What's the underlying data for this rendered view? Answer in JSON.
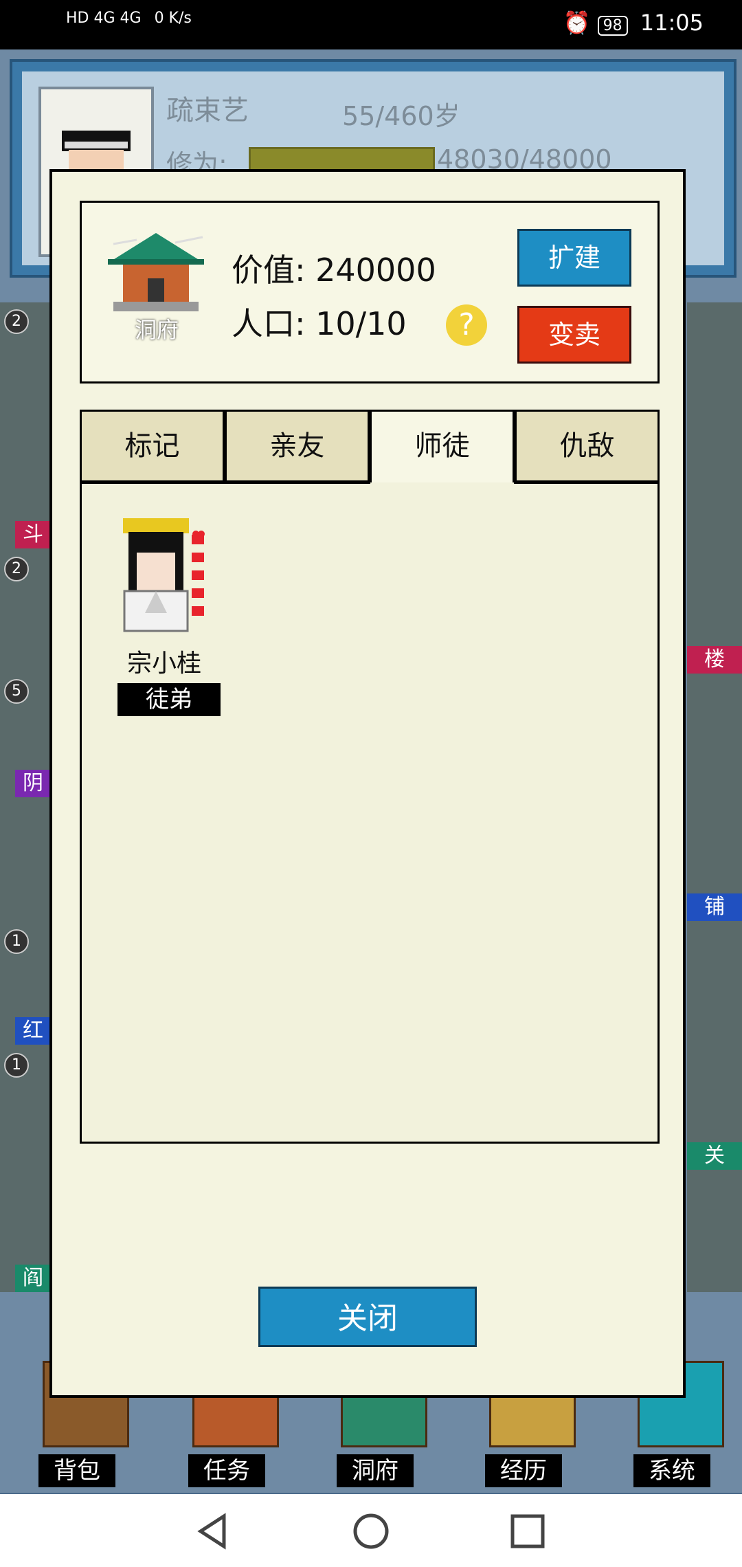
{
  "status_bar": {
    "network": "HD 4G 4G",
    "speed": "0 K/s",
    "battery": "98",
    "time": "11:05"
  },
  "header": {
    "name": "疏束艺",
    "age": "55/460岁",
    "xiuwei_label": "修为:",
    "xiuwei_value": "48030/48000",
    "xiuwei_progress": 1.0
  },
  "side_left": {
    "badges": [
      "2",
      "2",
      "5",
      "1",
      "1"
    ],
    "tags": [
      "斗",
      "阴",
      "红",
      "阎"
    ]
  },
  "side_right": {
    "tags": [
      "楼",
      "铺",
      "关"
    ]
  },
  "dialog": {
    "house_caption": "洞府",
    "value": "价值: 240000",
    "population": "人口: 10/10",
    "help": "?",
    "expand_button": "扩建",
    "sell_button": "变卖",
    "tabs": [
      {
        "label": "标记",
        "active": false
      },
      {
        "label": "亲友",
        "active": false
      },
      {
        "label": "师徒",
        "active": true
      },
      {
        "label": "仇敌",
        "active": false
      }
    ],
    "members": [
      {
        "name": "宗小桂",
        "role": "徒弟",
        "hearts": 5
      }
    ],
    "close_button": "关闭"
  },
  "bottom_nav": [
    {
      "label": "背包",
      "icon": "bag-icon"
    },
    {
      "label": "任务",
      "icon": "task-icon"
    },
    {
      "label": "洞府",
      "icon": "cave-house-icon"
    },
    {
      "label": "经历",
      "icon": "book-icon"
    },
    {
      "label": "系统",
      "icon": "gear-icon"
    }
  ],
  "colors": {
    "dialog_bg": "#f4f4e0",
    "expand_blue": "#1e8ec4",
    "sell_red": "#e43a16",
    "tab_inactive": "#e5e0bd",
    "help_yellow": "#f2d23a",
    "heart_red": "#e8242c"
  }
}
